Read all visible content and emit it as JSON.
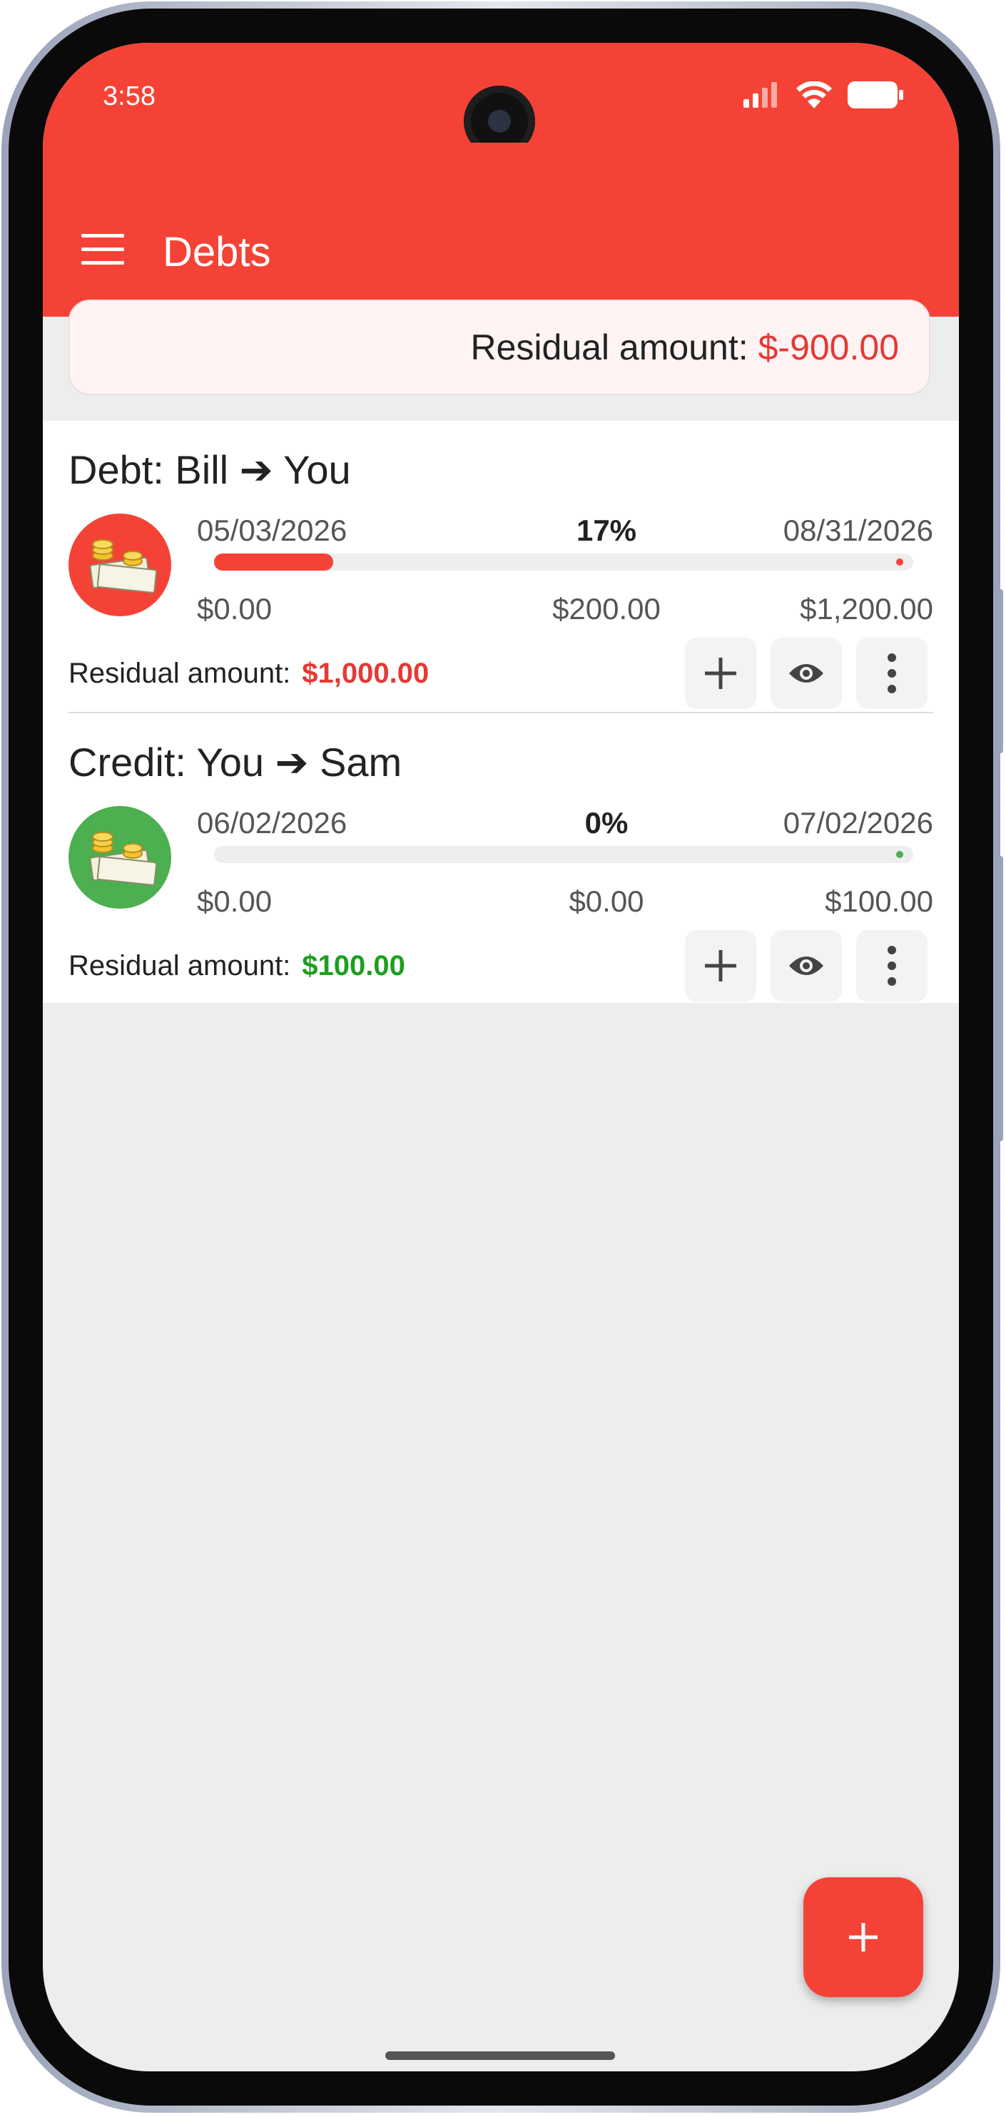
{
  "status_bar": {
    "time": "3:58",
    "icons": [
      "signal-icon",
      "wifi-icon",
      "battery-icon"
    ]
  },
  "app_bar": {
    "title": "Debts",
    "menu_icon": "menu-icon"
  },
  "summary": {
    "label": "Residual amount:",
    "value": "$-900.00"
  },
  "colors": {
    "primary": "#f44336",
    "debt": "#f44336",
    "credit": "#4caf50",
    "negative_text": "#e53935",
    "positive_text": "#1e9e1e"
  },
  "items": [
    {
      "title": "Debt: Bill ➔ You",
      "type": "debt",
      "start_date": "05/03/2026",
      "end_date": "08/31/2026",
      "percent_label": "17%",
      "progress": 0.17,
      "min_amount": "$0.00",
      "paid_amount": "$200.00",
      "total_amount": "$1,200.00",
      "residual_label": "Residual amount:",
      "residual_value": "$1,000.00",
      "actions": [
        "add-icon",
        "eye-icon",
        "more-vertical-icon"
      ]
    },
    {
      "title": "Credit: You ➔ Sam",
      "type": "credit",
      "start_date": "06/02/2026",
      "end_date": "07/02/2026",
      "percent_label": "0%",
      "progress": 0,
      "min_amount": "$0.00",
      "paid_amount": "$0.00",
      "total_amount": "$100.00",
      "residual_label": "Residual amount:",
      "residual_value": "$100.00",
      "actions": [
        "add-icon",
        "eye-icon",
        "more-vertical-icon"
      ]
    }
  ],
  "fab": {
    "icon": "add-icon"
  }
}
